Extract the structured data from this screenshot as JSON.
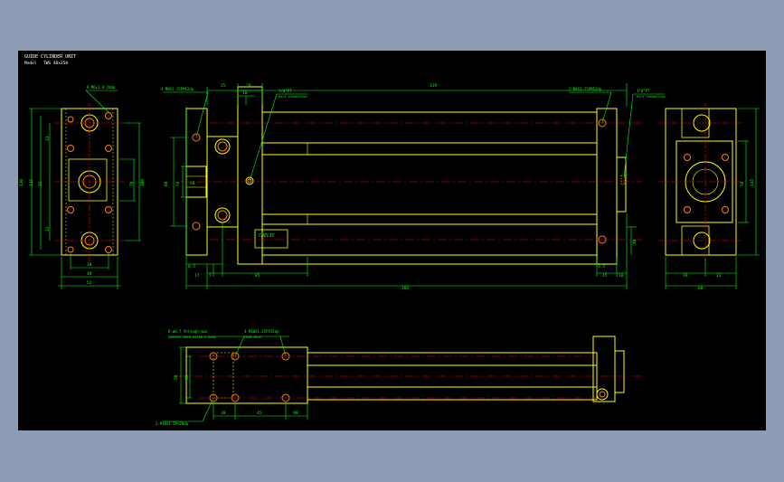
{
  "title_block": {
    "title": "GUIDE CYLINDER UNIT",
    "model_label": "Model",
    "model_value": "TWS 40x250"
  },
  "callouts": {
    "end_plate_holes": "8-M6x1.0 20dp",
    "guide_rod_threads_front": "4-M8X1.25PM12dp",
    "port_front": "1/8\"PT",
    "port_front_note": "Port connection",
    "rod_end_threads": "2-M8X1.25PM12dp",
    "port_rear": "1/8\"PT",
    "port_rear_note": "Port connection",
    "bottom_counterbore": "8-ø6.7 through-max",
    "bottom_counterbore_note": "Counter bore ø11X6.5 Deep",
    "bottom_tap": "4-M10X1.25PX15dp",
    "bottom_tap_note": "FROM BACK",
    "bottom_pins": "2-M10X1.5Pù20dp",
    "brand_label": "CHELIC"
  },
  "dims": {
    "top_25": "25",
    "top_20": "20",
    "top_10": "10",
    "top_stroke": "319",
    "left_50": "50",
    "left_100": "100",
    "left_33a": "33",
    "left_33b": "33",
    "left_130": "130",
    "left_115": "115",
    "left_25": "25",
    "left_78": "78",
    "left_90": "90",
    "left_bot_30": "30",
    "left_bot_48": "48",
    "left_bot_52": "52",
    "main_80": "80",
    "main_56": "56",
    "main_66": "66",
    "main_bot_85": "8.5",
    "main_bot_17": "17",
    "main_bot_5": "5",
    "main_bot_85b": "85",
    "main_bot_total": "383",
    "main_bot_15": "15",
    "main_bot_10": "10",
    "main_bot_35": "3.5",
    "main_right_40": "40",
    "right_bot_39": "39",
    "right_bot_23": "23",
    "right_bot_68": "68",
    "right_side_145": "145",
    "right_side_56": "56",
    "bv_20": "20",
    "bv_38": "38",
    "bv_30": "30",
    "bv_45": "45",
    "bv_90": "90"
  },
  "colors": {
    "outline": "#ffff00",
    "dimension": "#00ff00",
    "centerline": "#ff0000",
    "holes": "#ff8000",
    "hidden": "#ffff00",
    "text": "#ffffff",
    "sheet": "#000000",
    "background": "#8d9cb4"
  }
}
